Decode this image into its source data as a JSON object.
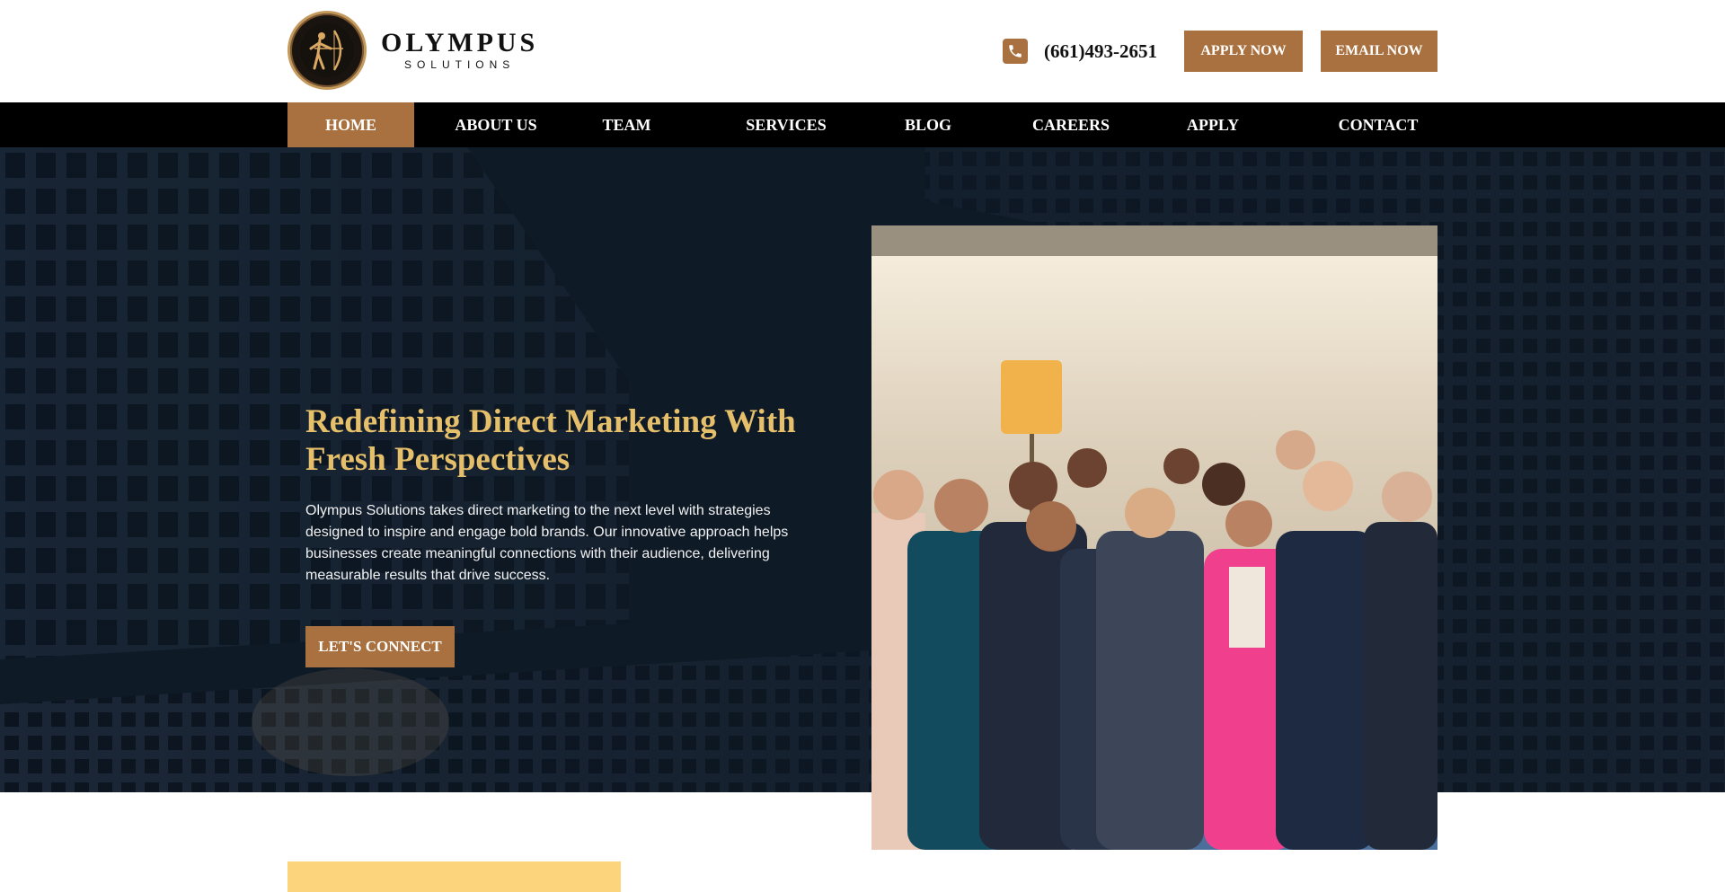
{
  "brand": {
    "name": "OLYMPUS",
    "tagline": "SOLUTIONS"
  },
  "contact": {
    "phone": "(661)493-2651",
    "apply_label": "APPLY NOW",
    "email_label": "EMAIL NOW"
  },
  "nav": [
    {
      "label": "HOME",
      "active": true
    },
    {
      "label": "ABOUT US"
    },
    {
      "label": "TEAM"
    },
    {
      "label": "SERVICES"
    },
    {
      "label": "BLOG"
    },
    {
      "label": "CAREERS"
    },
    {
      "label": "APPLY"
    },
    {
      "label": "CONTACT"
    }
  ],
  "hero": {
    "title": "Redefining Direct Marketing With Fresh Perspectives",
    "description": "Olympus Solutions takes direct marketing to the next level with strategies designed to inspire and engage bold brands. Our innovative approach helps businesses create meaningful connections with their audience, delivering measurable results that drive success.",
    "cta_label": "LET'S CONNECT"
  },
  "colors": {
    "accent": "#a8713f",
    "headline": "#e6bf6b",
    "hero_bg": "#0f1a27",
    "highlight": "#fbd47c"
  },
  "icons": {
    "phone": "phone-icon",
    "logo": "archer-logo-icon"
  }
}
